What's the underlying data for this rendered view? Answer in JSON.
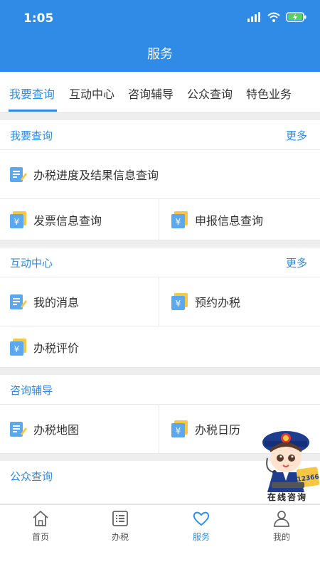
{
  "status_bar": {
    "time": "1:05"
  },
  "header": {
    "title": "服务"
  },
  "tabs": [
    {
      "label": "我要查询"
    },
    {
      "label": "互动中心"
    },
    {
      "label": "咨询辅导"
    },
    {
      "label": "公众查询"
    },
    {
      "label": "特色业务"
    }
  ],
  "sections": {
    "query": {
      "title": "我要查询",
      "more": "更多",
      "items": [
        {
          "label": "办税进度及结果信息查询",
          "icon": "document-icon"
        },
        {
          "label": "发票信息查询",
          "icon": "yen-card-icon"
        },
        {
          "label": "申报信息查询",
          "icon": "yen-card-icon"
        }
      ]
    },
    "interaction": {
      "title": "互动中心",
      "more": "更多",
      "items": [
        {
          "label": "我的消息",
          "icon": "document-icon"
        },
        {
          "label": "预约办税",
          "icon": "yen-card-icon"
        },
        {
          "label": "办税评价",
          "icon": "yen-card-icon"
        }
      ]
    },
    "consult": {
      "title": "咨询辅导",
      "items": [
        {
          "label": "办税地图",
          "icon": "document-icon"
        },
        {
          "label": "办税日历",
          "icon": "yen-card-icon"
        }
      ]
    },
    "public": {
      "title": "公众查询"
    }
  },
  "mascot": {
    "badge": "12366",
    "label": "在线咨询"
  },
  "tabbar": [
    {
      "label": "首页",
      "icon": "home-icon"
    },
    {
      "label": "办税",
      "icon": "list-icon"
    },
    {
      "label": "服务",
      "icon": "heart-icon"
    },
    {
      "label": "我的",
      "icon": "person-icon"
    }
  ],
  "colors": {
    "primary": "#2f8be6",
    "icon_blue": "#5aa8f0",
    "icon_yellow": "#f7c744"
  }
}
